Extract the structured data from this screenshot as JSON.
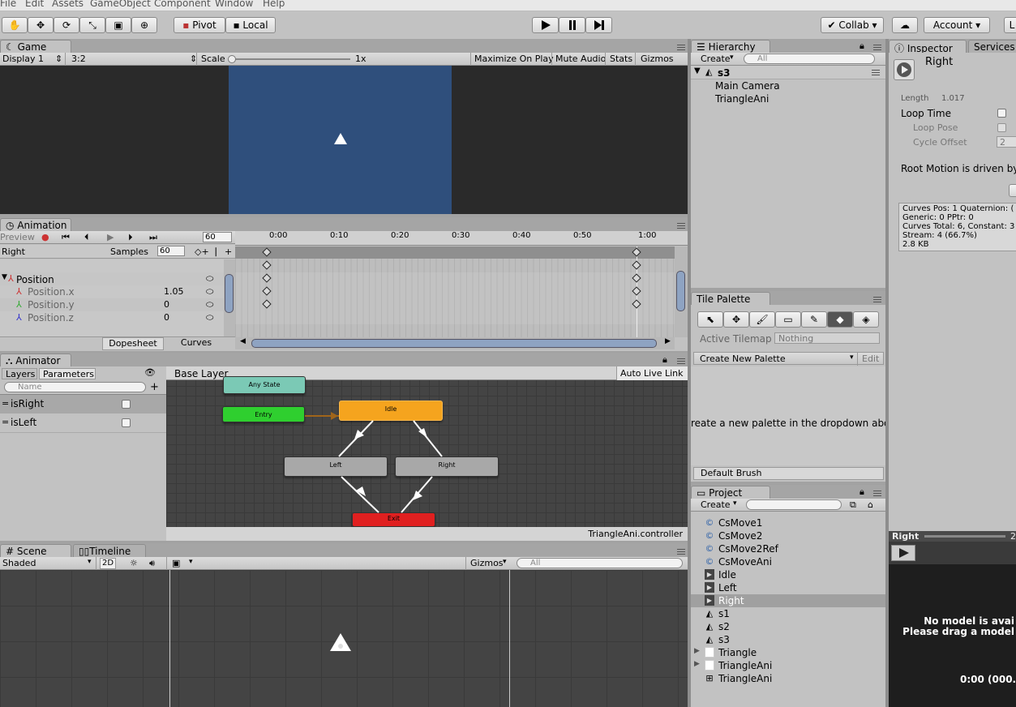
{
  "menu": [
    "File",
    "Edit",
    "Assets",
    "GameObject",
    "Component",
    "Window",
    "Help"
  ],
  "toolbar": {
    "pivot": "Pivot",
    "local": "Local",
    "collab": "Collab ▾",
    "account": "Account",
    "layers": "L"
  },
  "game": {
    "tab": "Game",
    "display": "Display 1",
    "aspect": "3:2",
    "scale_label": "Scale",
    "scale_value": "1x",
    "maximize": "Maximize On Play",
    "mute": "Mute Audio",
    "stats": "Stats",
    "gizmos": "Gizmos",
    "bg_color": "#2f4f7c"
  },
  "animation": {
    "tab": "Animation",
    "preview": "Preview",
    "frame": "60",
    "clip": "Right",
    "samples_label": "Samples",
    "samples": "60",
    "ticks": [
      "0:00",
      "0:10",
      "0:20",
      "0:30",
      "0:40",
      "0:50",
      "1:00"
    ],
    "properties": [
      {
        "name": "Position",
        "value": ""
      },
      {
        "name": "Position.x",
        "value": "1.05"
      },
      {
        "name": "Position.y",
        "value": "0"
      },
      {
        "name": "Position.z",
        "value": "0"
      }
    ],
    "dopesheet": "Dopesheet",
    "curves": "Curves"
  },
  "animator": {
    "tab": "Animator",
    "layers_tab": "Layers",
    "params_tab": "Parameters",
    "search_placeholder": "Name",
    "base_layer": "Base Layer",
    "auto_live": "Auto Live Link",
    "controller": "TriangleAni.controller",
    "params": [
      {
        "name": "isRight"
      },
      {
        "name": "isLeft"
      }
    ],
    "states": {
      "any": "Any State",
      "entry": "Entry",
      "idle": "Idle",
      "left": "Left",
      "right": "Right",
      "exit": "Exit"
    }
  },
  "scene": {
    "tab": "Scene",
    "timeline_tab": "Timeline",
    "shading": "Shaded",
    "mode2d": "2D",
    "gizmos": "Gizmos",
    "search_placeholder": "All"
  },
  "hierarchy": {
    "tab": "Hierarchy",
    "create": "Create",
    "search_placeholder": "All",
    "scene": "s3",
    "items": [
      "Main Camera",
      "TriangleAni"
    ]
  },
  "tile_palette": {
    "tab": "Tile Palette",
    "active_tilemap_label": "Active Tilemap",
    "active_tilemap": "Nothing",
    "create_new": "Create New Palette",
    "edit": "Edit",
    "message": "reate a new palette in the dropdown abov",
    "brush": "Default Brush"
  },
  "project": {
    "tab": "Project",
    "create": "Create",
    "items": [
      {
        "name": "CsMove1",
        "icon": "script-icon"
      },
      {
        "name": "CsMove2",
        "icon": "script-icon"
      },
      {
        "name": "CsMove2Ref",
        "icon": "script-icon"
      },
      {
        "name": "CsMoveAni",
        "icon": "script-icon"
      },
      {
        "name": "Idle",
        "icon": "anim-clip-icon"
      },
      {
        "name": "Left",
        "icon": "anim-clip-icon"
      },
      {
        "name": "Right",
        "icon": "anim-clip-icon"
      },
      {
        "name": "s1",
        "icon": "unity-scene-icon"
      },
      {
        "name": "s2",
        "icon": "unity-scene-icon"
      },
      {
        "name": "s3",
        "icon": "unity-scene-icon"
      },
      {
        "name": "Triangle",
        "icon": "sprite-icon"
      },
      {
        "name": "TriangleAni",
        "icon": "sprite-icon"
      },
      {
        "name": "TriangleAni",
        "icon": "animator-controller-icon"
      }
    ],
    "selected": "Right"
  },
  "inspector": {
    "tab": "Inspector",
    "services_tab": "Services",
    "title": "Right",
    "length_label": "Length",
    "length": "1.017",
    "loop_time": "Loop Time",
    "loop_pose": "Loop Pose",
    "cycle_offset": "Cycle Offset",
    "cycle_value": "2",
    "root_motion": "Root Motion is driven by",
    "info": [
      "Curves Pos: 1 Quaternion: (",
      "Generic: 0 PPtr: 0",
      "Curves Total: 6, Constant: 3",
      "Stream: 4 (66.7%)",
      "2.8 KB"
    ],
    "preview_title": "Right",
    "preview_speed": "2",
    "no_model_1": "No model is avai",
    "no_model_2": "Please drag a model",
    "preview_time": "0:00 (000."
  }
}
